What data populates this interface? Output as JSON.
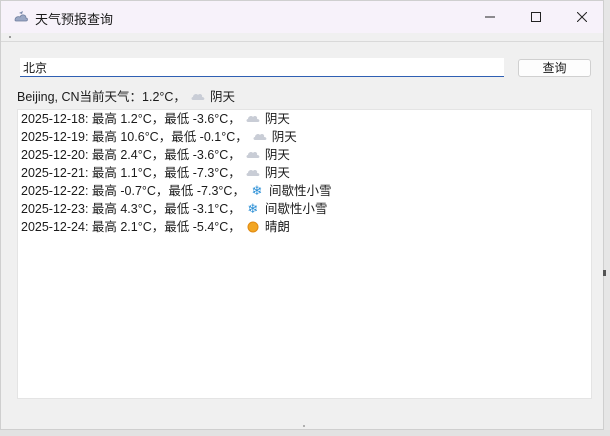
{
  "window": {
    "title": "天气预报查询",
    "minimize": "minimize",
    "maximize": "maximize",
    "close": "close"
  },
  "search": {
    "value": "北京",
    "button_label": "查询"
  },
  "current": {
    "text": "Beijing, CN当前天气：1.2°C，",
    "condition": "阴天",
    "icon": "cloud-icon"
  },
  "forecast": [
    {
      "date": "2025-12-18",
      "summary": "2025-12-18: 最高 1.2°C，最低 -3.6°C，",
      "condition": "阴天",
      "icon": "cloud"
    },
    {
      "date": "2025-12-19",
      "summary": "2025-12-19: 最高 10.6°C，最低 -0.1°C，",
      "condition": "阴天",
      "icon": "cloud"
    },
    {
      "date": "2025-12-20",
      "summary": "2025-12-20: 最高 2.4°C，最低 -3.6°C，",
      "condition": "阴天",
      "icon": "cloud"
    },
    {
      "date": "2025-12-21",
      "summary": "2025-12-21: 最高 1.1°C，最低 -7.3°C，",
      "condition": "阴天",
      "icon": "cloud"
    },
    {
      "date": "2025-12-22",
      "summary": "2025-12-22: 最高 -0.7°C，最低 -7.3°C，",
      "condition": "间歇性小雪",
      "icon": "snow"
    },
    {
      "date": "2025-12-23",
      "summary": "2025-12-23: 最高 4.3°C，最低 -3.1°C，",
      "condition": "间歇性小雪",
      "icon": "snow"
    },
    {
      "date": "2025-12-24",
      "summary": "2025-12-24: 最高 2.1°C，最低 -5.4°C，",
      "condition": "晴朗",
      "icon": "sun"
    }
  ],
  "colors": {
    "accent": "#2f5fb3",
    "snow": "#2a8fd6",
    "sun": "#f2a623",
    "cloud": "#c9cdd6"
  }
}
